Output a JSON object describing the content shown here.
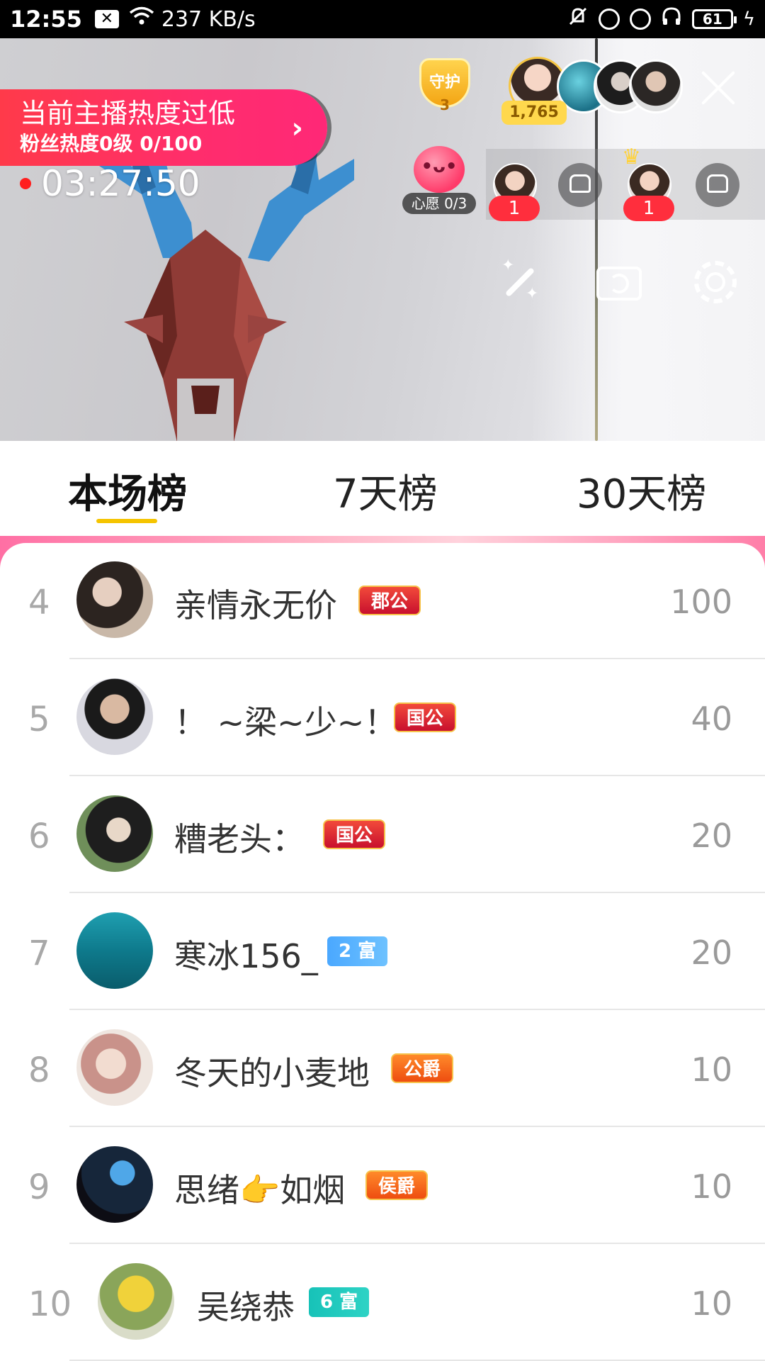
{
  "status_bar": {
    "time": "12:55",
    "network_speed": "237 KB/s",
    "battery": "61",
    "icons": [
      "notification-x-icon",
      "wifi-icon",
      "mute-icon",
      "lock-icon",
      "alarm-icon",
      "headphones-icon",
      "battery-icon",
      "charging-icon"
    ]
  },
  "stream": {
    "heat_banner": {
      "line1": "当前主播热度过低",
      "line2": "粉丝热度0级 0/100",
      "arrow": "›"
    },
    "guard_badge": {
      "label": "守护",
      "count": "3"
    },
    "audience_count": "1,765",
    "timer": "03:27:50",
    "wish": {
      "face": "•ᴗ•",
      "label": "心愿 0/3"
    },
    "seat_counts": [
      "1",
      "1"
    ]
  },
  "tabs": [
    {
      "label": "本场榜",
      "active": true
    },
    {
      "label": "7天榜",
      "active": false
    },
    {
      "label": "30天榜",
      "active": false
    }
  ],
  "ranking": [
    {
      "rank": "4",
      "name": "亲情永无价",
      "badge": "郡公",
      "badge_type": "noble",
      "score": "100"
    },
    {
      "rank": "5",
      "name": "！ ~梁~少~！",
      "badge": "国公",
      "badge_type": "noble",
      "score": "40"
    },
    {
      "rank": "6",
      "name": "糟老头：",
      "badge": "国公",
      "badge_type": "noble",
      "score": "20"
    },
    {
      "rank": "7",
      "name": "寒冰156_",
      "badge": "2 富",
      "badge_type": "rich-blue",
      "score": "20"
    },
    {
      "rank": "8",
      "name": "冬天的小麦地",
      "badge": "公爵",
      "badge_type": "noble-orange",
      "score": "10"
    },
    {
      "rank": "9",
      "name": "思绪👉如烟",
      "badge": "侯爵",
      "badge_type": "noble-orange",
      "score": "10"
    },
    {
      "rank": "10",
      "name": "吴绕恭",
      "badge": "6 富",
      "badge_type": "rich-teal",
      "score": "10"
    }
  ],
  "colors": {
    "banner_red": "#ff2d6c",
    "tab_indicator": "#f5c400",
    "live_dot": "#ff1f1f",
    "noble_badge": "#c8102e",
    "rich_blue": "#4aa8ff",
    "rich_teal": "#17c2b8"
  }
}
